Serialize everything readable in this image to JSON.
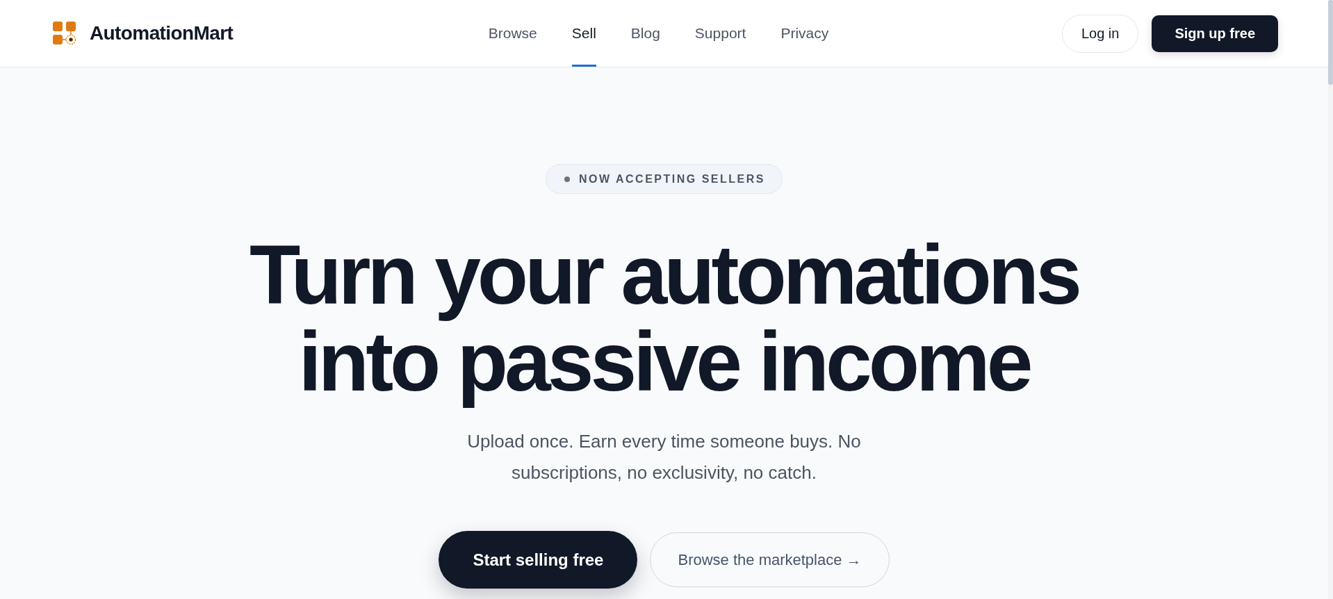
{
  "brand": {
    "name": "AutomationMart"
  },
  "nav": [
    {
      "label": "Browse",
      "selected": false
    },
    {
      "label": "Sell",
      "selected": true
    },
    {
      "label": "Blog",
      "selected": false
    },
    {
      "label": "Support",
      "selected": false
    },
    {
      "label": "Privacy",
      "selected": false
    }
  ],
  "header_actions": [
    {
      "label": "Log in",
      "kind": "outline"
    },
    {
      "label": "Sign up free",
      "kind": "solid"
    }
  ],
  "hero": {
    "badge": "NOW ACCEPTING SELLERS",
    "headline": "Turn your automations into passive income",
    "subtitle": "Upload once. Earn every time someone buys. No subscriptions, no exclusivity, no catch.",
    "buttons": [
      {
        "label": "Start selling free",
        "kind": "primary"
      },
      {
        "label": "Browse the marketplace →",
        "kind": "secondary"
      }
    ]
  }
}
